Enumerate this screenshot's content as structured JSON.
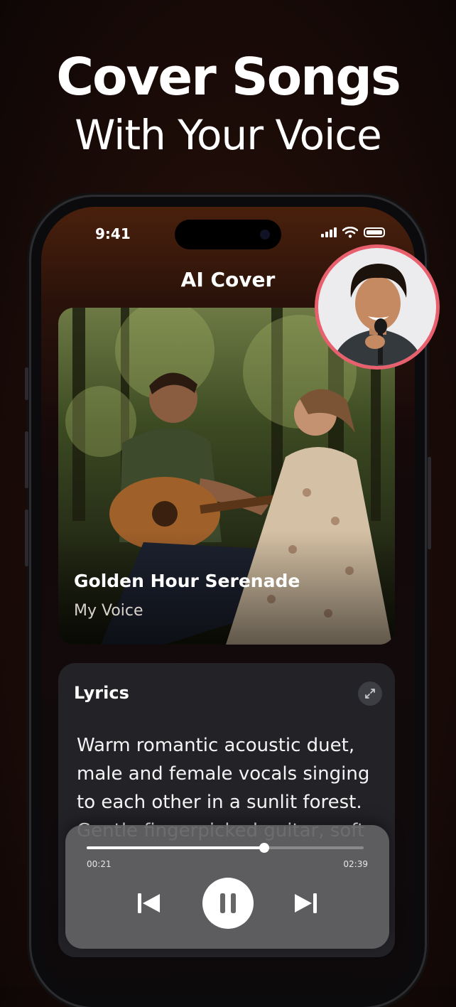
{
  "headline": {
    "title": "Cover Songs",
    "subtitle": "With Your Voice"
  },
  "status_bar": {
    "time": "9:41"
  },
  "screen": {
    "title": "AI Cover"
  },
  "song": {
    "title": "Golden Hour Serenade",
    "artist": "My Voice"
  },
  "lyrics": {
    "heading": "Lyrics",
    "text": "Warm romantic acoustic duet, male and female vocals singing to each other in a sunlit forest. Gentle fingerpicked guitar, soft"
  },
  "player": {
    "current_time": "00:21",
    "total_time": "02:39",
    "progress": 0.64
  },
  "colors": {
    "accent_ring": "#e8606e",
    "background": "#1f0d08"
  },
  "icons": [
    "signal-icon",
    "wifi-icon",
    "battery-icon",
    "expand-icon",
    "previous-icon",
    "pause-icon",
    "next-icon"
  ]
}
